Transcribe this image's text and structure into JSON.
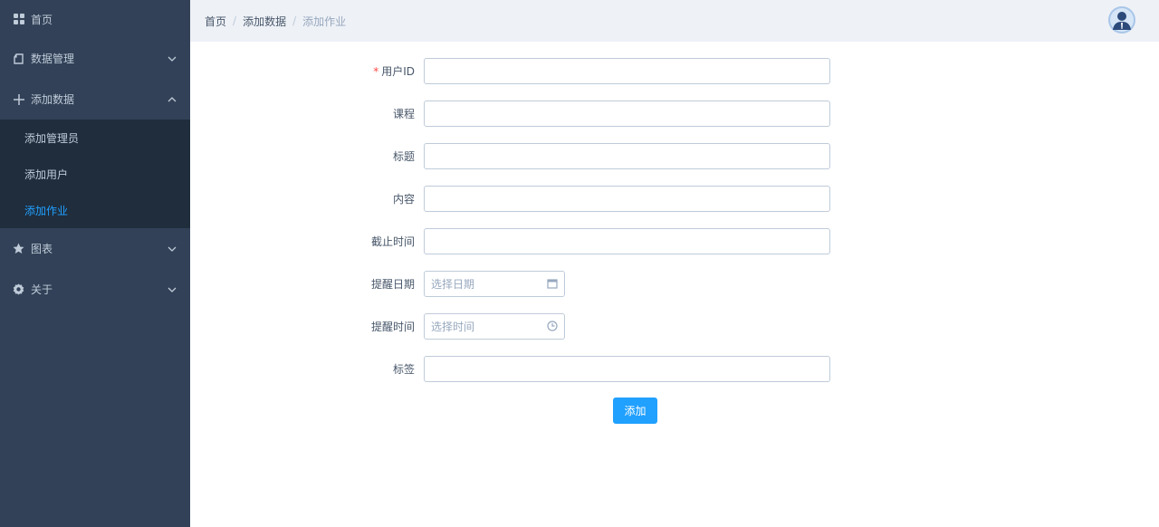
{
  "sidebar": {
    "items": [
      {
        "label": "首页",
        "icon": "grid-icon"
      },
      {
        "label": "数据管理",
        "icon": "document-icon",
        "expanded": false
      },
      {
        "label": "添加数据",
        "icon": "plus-icon",
        "expanded": true,
        "children": [
          {
            "label": "添加管理员"
          },
          {
            "label": "添加用户"
          },
          {
            "label": "添加作业",
            "active": true
          }
        ]
      },
      {
        "label": "图表",
        "icon": "star-icon",
        "expanded": false
      },
      {
        "label": "关于",
        "icon": "gear-icon",
        "expanded": false
      }
    ]
  },
  "header": {
    "breadcrumb": [
      "首页",
      "添加数据",
      "添加作业"
    ],
    "separator": "/"
  },
  "form": {
    "user_id": {
      "label": "用户ID",
      "required_mark": "*",
      "value": ""
    },
    "course": {
      "label": "课程",
      "value": ""
    },
    "title": {
      "label": "标题",
      "value": ""
    },
    "content": {
      "label": "内容",
      "value": ""
    },
    "deadline": {
      "label": "截止时间",
      "value": ""
    },
    "remind_date": {
      "label": "提醒日期",
      "placeholder": "选择日期"
    },
    "remind_time": {
      "label": "提醒时间",
      "placeholder": "选择时间"
    },
    "tags": {
      "label": "标签",
      "value": ""
    },
    "submit_label": "添加"
  },
  "colors": {
    "sidebar_bg": "#324157",
    "submenu_bg": "#1f2d3d",
    "sidebar_text": "#bfcbd9",
    "active": "#20a0ff",
    "header_bg": "#eef1f6",
    "required": "#ff4949"
  }
}
